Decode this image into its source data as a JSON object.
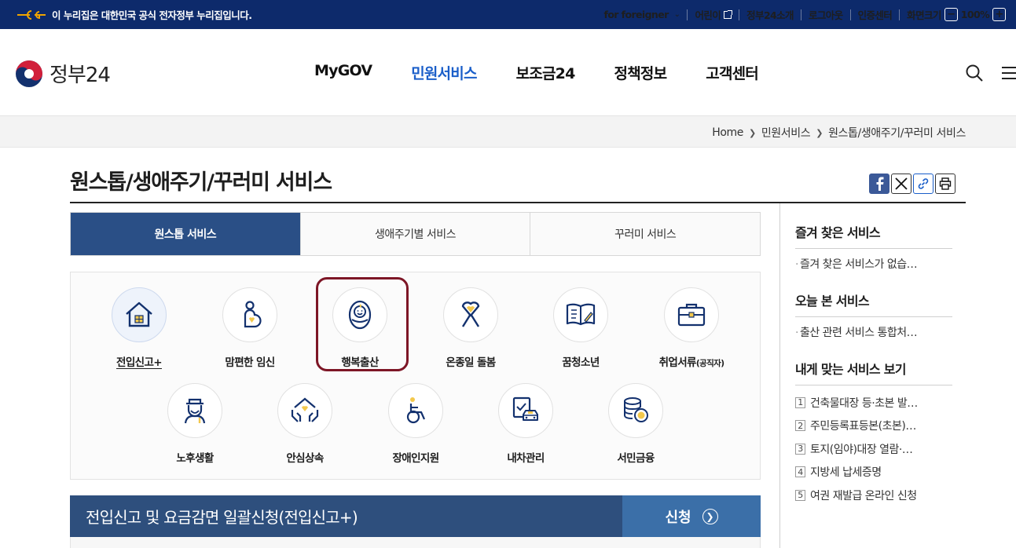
{
  "banner": {
    "notice": "이 누리집은 대한민국 공식 전자정부 누리집입니다.",
    "links": [
      "for foreigner",
      "어린이",
      "정부24소개",
      "로그아웃",
      "인증센터",
      "화면크기"
    ],
    "zoom": "100%"
  },
  "header": {
    "logo_text": "정부24",
    "nav": [
      "MyGOV",
      "민원서비스",
      "보조금24",
      "정책정보",
      "고객센터"
    ],
    "active_nav": "민원서비스"
  },
  "breadcrumb": [
    "Home",
    "민원서비스",
    "원스톱/생애주기/꾸러미 서비스"
  ],
  "page_title": "원스톱/생애주기/꾸러미 서비스",
  "tabs": [
    "원스톱 서비스",
    "생애주기별 서비스",
    "꾸러미 서비스"
  ],
  "active_tab": "원스톱 서비스",
  "services": [
    {
      "label": "전입신고+",
      "icon": "house-icon"
    },
    {
      "label": "맘편한 임신",
      "icon": "pregnant-icon"
    },
    {
      "label": "행복출산",
      "icon": "baby-icon"
    },
    {
      "label": "온종일 돌봄",
      "icon": "ribbon-icon"
    },
    {
      "label": "꿈청소년",
      "icon": "book-icon"
    },
    {
      "label": "취업서류",
      "label_suffix": "(공직자)",
      "icon": "briefcase-icon"
    },
    {
      "label": "노후생활",
      "icon": "elder-icon"
    },
    {
      "label": "안심상속",
      "icon": "hands-heart-icon"
    },
    {
      "label": "장애인지원",
      "icon": "wheelchair-icon"
    },
    {
      "label": "내차관리",
      "icon": "car-icon"
    },
    {
      "label": "서민금융",
      "icon": "coins-icon"
    }
  ],
  "apply_bar": {
    "title": "전입신고 및 요금감면 일괄신청(전입신고+)",
    "button": "신청"
  },
  "sidebar": {
    "favorites_title": "즐겨 찾은 서비스",
    "favorites_item": "즐겨 찾은 서비스가 없습…",
    "today_title": "오늘 본 서비스",
    "today_item": "출산 관련 서비스 통합처…",
    "recommend_title": "내게 맞는 서비스 보기",
    "recommend": [
      "건축물대장 등·초본 발…",
      "주민등록표등본(초본)…",
      "토지(임야)대장 열람·…",
      "지방세 납세증명",
      "여권 재발급 온라인 신청"
    ]
  },
  "colors": {
    "banner_bg": "#0d2a6b",
    "accent": "#1a5ec9",
    "tab_active": "#2a4f86",
    "highlight": "#7d1626",
    "apply_bg": "#2e4f7d",
    "apply_btn": "#3b6fa8"
  }
}
